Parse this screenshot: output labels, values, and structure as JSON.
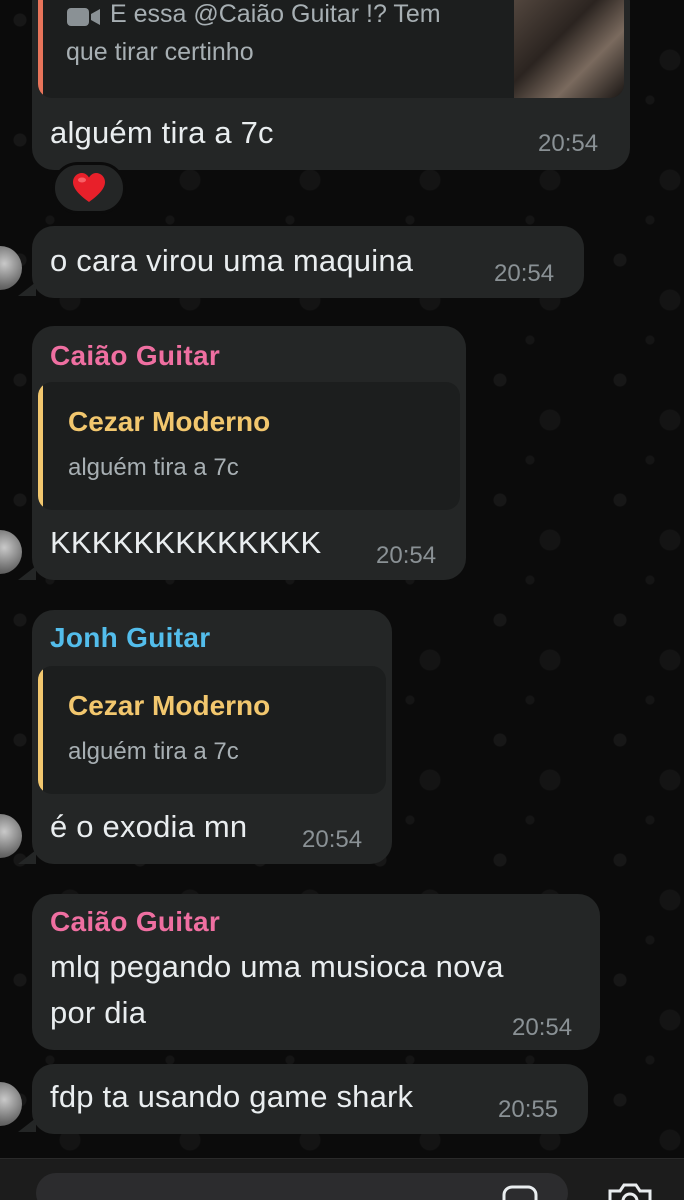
{
  "colors": {
    "bubble_bg": "#242626",
    "quote_bg": "#1c1e1e",
    "time_color": "#8a9195",
    "caiao_color": "#ef6fa1",
    "jonh_color": "#53bdeb",
    "cezar_color": "#f2c76e",
    "reply_bar_orange": "#e8745a"
  },
  "messages": [
    {
      "reply_preview": {
        "icon": "video-camera-icon",
        "text_line1": "E essa @Caião Guitar !? Tem",
        "text_line2": "que tirar certinho"
      },
      "text": "alguém tira a 7c",
      "time": "20:54",
      "reaction": "❤️"
    },
    {
      "text": "o cara virou uma maquina",
      "time": "20:54"
    },
    {
      "sender": "Caião Guitar",
      "quote": {
        "name": "Cezar Moderno",
        "text": "alguém tira a 7c"
      },
      "text": "KKKKKKKKKKKKK",
      "time": "20:54"
    },
    {
      "sender": "Jonh Guitar",
      "quote": {
        "name": "Cezar Moderno",
        "text": "alguém tira a 7c"
      },
      "text": "é o exodia mn",
      "time": "20:54"
    },
    {
      "sender": "Caião Guitar",
      "text_line1": "mlq pegando uma musioca nova",
      "text_line2": "por dia",
      "time": "20:54"
    },
    {
      "text": "fdp ta usando game shark",
      "time": "20:55"
    }
  ],
  "input_bar": {
    "camera_icon": "camera-icon",
    "sticker_icon": "sticker-icon"
  }
}
